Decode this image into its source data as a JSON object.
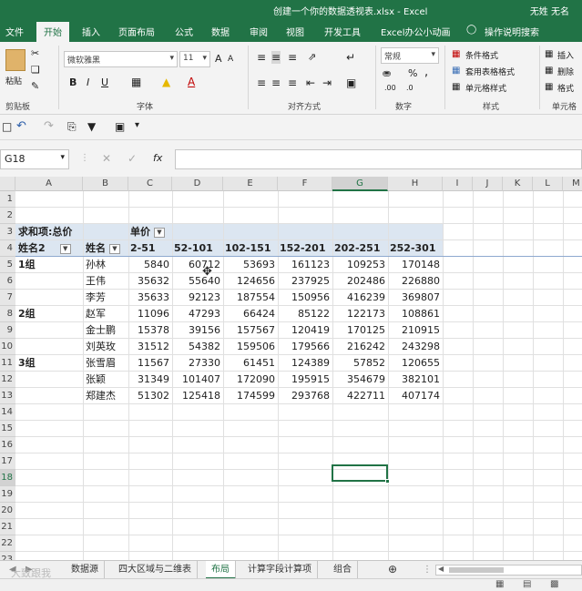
{
  "window": {
    "title": "创建一个你的数据透视表.xlsx - Excel",
    "user": "无姓 无名"
  },
  "ribbon_tabs": [
    "文件",
    "开始",
    "插入",
    "页面布局",
    "公式",
    "数据",
    "审阅",
    "视图",
    "开发工具",
    "Excel办公小动画"
  ],
  "active_tab": "开始",
  "tell_me": "操作说明搜索",
  "ribbon": {
    "clipboard": {
      "paste": "粘贴",
      "label": "剪贴板"
    },
    "font": {
      "name": "微软雅黑",
      "size": "11",
      "label": "字体",
      "bold": "B",
      "italic": "I",
      "underline": "U",
      "grow": "A",
      "shrink": "A"
    },
    "alignment": {
      "label": "对齐方式"
    },
    "number": {
      "format": "常规",
      "label": "数字",
      "percent": "%",
      "comma": ","
    },
    "styles": {
      "conditional": "条件格式",
      "table": "套用表格格式",
      "cell": "单元格样式",
      "label": "样式"
    },
    "cells": {
      "insert": "插入",
      "delete": "删除",
      "format": "格式",
      "label": "单元格"
    }
  },
  "formula_bar": {
    "name_box": "G18",
    "fx": "fx",
    "value": ""
  },
  "columns": [
    "A",
    "B",
    "C",
    "D",
    "E",
    "F",
    "G",
    "H",
    "I",
    "J",
    "K",
    "L",
    "M"
  ],
  "selected_column": "G",
  "rows": [
    "1",
    "2",
    "3",
    "4",
    "5",
    "6",
    "7",
    "8",
    "9",
    "10",
    "11",
    "12",
    "13",
    "14",
    "15",
    "16",
    "17",
    "18",
    "19",
    "20",
    "21",
    "22",
    "23"
  ],
  "selected_row": "18",
  "pivot": {
    "header_row": {
      "label": "求和项:总价",
      "field": "单价"
    },
    "col_headers": [
      "姓名2",
      "姓名",
      "2-51",
      "52-101",
      "102-151",
      "152-201",
      "202-251",
      "252-301"
    ],
    "groups": [
      {
        "name": "1组",
        "rows": [
          {
            "name": "孙林",
            "values": [
              "5840",
              "60712",
              "53693",
              "161123",
              "109253",
              "170148"
            ]
          },
          {
            "name": "王伟",
            "values": [
              "35632",
              "55640",
              "124656",
              "237925",
              "202486",
              "226880"
            ]
          },
          {
            "name": "李芳",
            "values": [
              "35633",
              "92123",
              "187554",
              "150956",
              "416239",
              "369807"
            ]
          }
        ]
      },
      {
        "name": "2组",
        "rows": [
          {
            "name": "赵军",
            "values": [
              "11096",
              "47293",
              "66424",
              "85122",
              "122173",
              "108861"
            ]
          },
          {
            "name": "金士鹏",
            "values": [
              "15378",
              "39156",
              "157567",
              "120419",
              "170125",
              "210915"
            ]
          },
          {
            "name": "刘英玫",
            "values": [
              "31512",
              "54382",
              "159506",
              "179566",
              "216242",
              "243298"
            ]
          }
        ]
      },
      {
        "name": "3组",
        "rows": [
          {
            "name": "张雪眉",
            "values": [
              "11567",
              "27330",
              "61451",
              "124389",
              "57852",
              "120655"
            ]
          },
          {
            "name": "张颖",
            "values": [
              "31349",
              "101407",
              "172090",
              "195915",
              "354679",
              "382101"
            ]
          },
          {
            "name": "郑建杰",
            "values": [
              "51302",
              "125418",
              "174599",
              "293768",
              "422711",
              "407174"
            ]
          }
        ]
      }
    ]
  },
  "sheet_tabs": [
    "数据源",
    "四大区域与二维表",
    "布局",
    "计算字段计算项",
    "组合"
  ],
  "active_sheet": "布局",
  "watermark": "大致跟我",
  "colors": {
    "excel_green": "#217346",
    "pivot_header": "#dce6f1",
    "selection": "#217346"
  }
}
